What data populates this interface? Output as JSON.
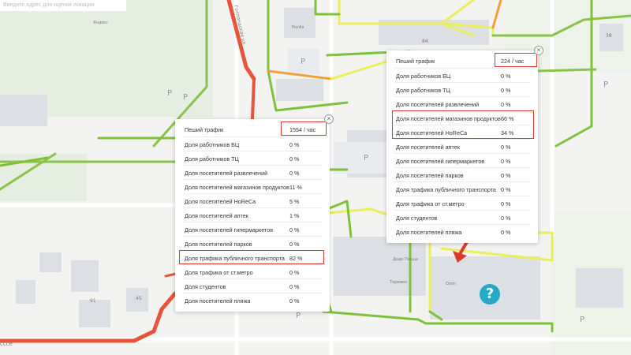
{
  "search": {
    "placeholder": "Введите адрес для оценки локации"
  },
  "map": {
    "street_label": "Голландская ул",
    "street_bottom": "сссе",
    "poi_labels": [
      "Яндекс",
      "РосАл",
      "Додо Пицца",
      "Теремок",
      "Ozon"
    ],
    "building_numbers": [
      "84",
      "38",
      "91",
      "45"
    ],
    "parking_letter": "P"
  },
  "popup_left": {
    "rows": [
      {
        "label": "Пеший трафик",
        "value": "1554 / час"
      },
      {
        "label": "Доля работников БЦ",
        "value": "0 %"
      },
      {
        "label": "Доля работников ТЦ",
        "value": "0 %"
      },
      {
        "label": "Доля посетителей развлечений",
        "value": "0 %"
      },
      {
        "label": "Доля посетителей магазинов продуктов",
        "value": "11 %"
      },
      {
        "label": "Доля посетителей HoReCa",
        "value": "5 %"
      },
      {
        "label": "Доля посетителей аптек",
        "value": "1 %"
      },
      {
        "label": "Доля посетителей гипермаркетов",
        "value": "0 %"
      },
      {
        "label": "Доля посетителей парков",
        "value": "0 %"
      },
      {
        "label": "Доля трафика публичного транспорта",
        "value": "82 %"
      },
      {
        "label": "Доля трафика от ст.метро",
        "value": "0 %"
      },
      {
        "label": "Доля студентов",
        "value": "0 %"
      },
      {
        "label": "Доля посетителей пляжа",
        "value": "0 %"
      }
    ]
  },
  "popup_right": {
    "rows": [
      {
        "label": "Пеший трафик",
        "value": "224 / час"
      },
      {
        "label": "Доля работников БЦ",
        "value": "0 %"
      },
      {
        "label": "Доля работников ТЦ",
        "value": "0 %"
      },
      {
        "label": "Доля посетителей развлечений",
        "value": "0 %"
      },
      {
        "label": "Доля посетителей магазинов продуктов",
        "value": "66 %"
      },
      {
        "label": "Доля посетителей HoReCa",
        "value": "34 %"
      },
      {
        "label": "Доля посетителей аптек",
        "value": "0 %"
      },
      {
        "label": "Доля посетителей гипермаркетов",
        "value": "0 %"
      },
      {
        "label": "Доля посетителей парков",
        "value": "0 %"
      },
      {
        "label": "Доля трафика публичного транспорта",
        "value": "0 %"
      },
      {
        "label": "Доля трафика от ст.метро",
        "value": "0 %"
      },
      {
        "label": "Доля студентов",
        "value": "0 %"
      },
      {
        "label": "Доля посетителей пляжа",
        "value": "0 %"
      }
    ]
  },
  "close_glyph": "×",
  "help_glyph": "?",
  "colors": {
    "traffic_high": "#e8543a",
    "traffic_mid": "#f0a03a",
    "traffic_low": "#e9ee5a",
    "traffic_min": "#7ec23a",
    "highlight": "#d93a2b",
    "help": "#27a9c8",
    "park": "#e6efe0"
  }
}
